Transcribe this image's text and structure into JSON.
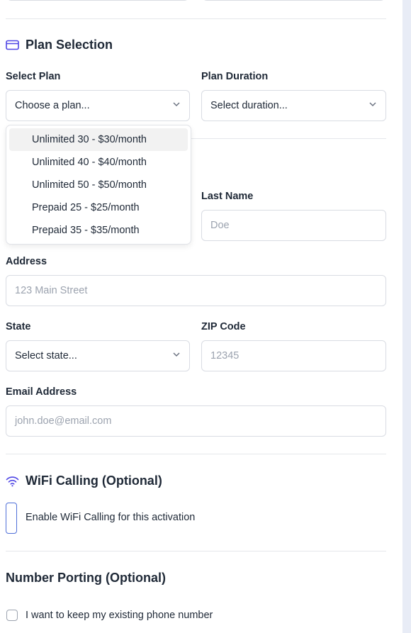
{
  "plan_section": {
    "title": "Plan Selection",
    "select_plan_label": "Select Plan",
    "select_plan_value": "Choose a plan...",
    "duration_label": "Plan Duration",
    "duration_value": "Select duration...",
    "options": [
      "Unlimited 30 - $30/month",
      "Unlimited 40 - $40/month",
      "Unlimited 50 - $50/month",
      "Prepaid 25 - $25/month",
      "Prepaid 35 - $35/month"
    ]
  },
  "customer": {
    "last_name_label": "Last Name",
    "last_name_placeholder": "Doe",
    "address_label": "Address",
    "address_placeholder": "123 Main Street",
    "state_label": "State",
    "state_value": "Select state...",
    "zip_label": "ZIP Code",
    "zip_placeholder": "12345",
    "email_label": "Email Address",
    "email_placeholder": "john.doe@email.com"
  },
  "wifi": {
    "title": "WiFi Calling (Optional)",
    "checkbox_label": "Enable WiFi Calling for this activation"
  },
  "porting": {
    "title": "Number Porting (Optional)",
    "checkbox_label": "I want to keep my existing phone number"
  },
  "colors": {
    "accent": "#4f46e5",
    "focus_border": "#4f6fd8",
    "scroll_track": "#e8ecf6"
  },
  "icons": {
    "plan": "credit-card-icon",
    "wifi": "wifi-icon",
    "select": "chevron-down-icon"
  }
}
